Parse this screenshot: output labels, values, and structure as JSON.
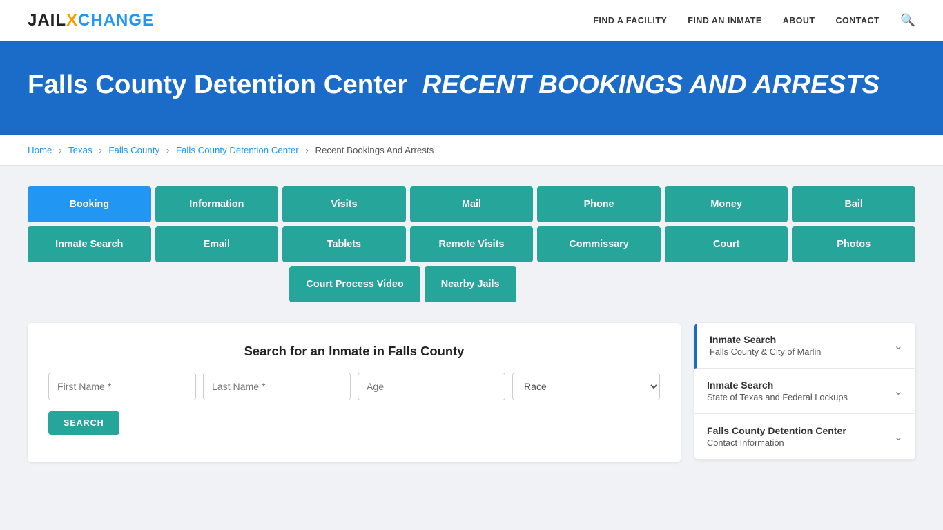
{
  "nav": {
    "logo_jail": "JAIL",
    "logo_x": "X",
    "logo_change": "CHANGE",
    "links": [
      {
        "label": "FIND A FACILITY",
        "href": "#"
      },
      {
        "label": "FIND AN INMATE",
        "href": "#"
      },
      {
        "label": "ABOUT",
        "href": "#"
      },
      {
        "label": "CONTACT",
        "href": "#"
      }
    ]
  },
  "hero": {
    "title_main": "Falls County Detention Center",
    "title_italic": "RECENT BOOKINGS AND ARRESTS"
  },
  "breadcrumb": {
    "items": [
      {
        "label": "Home",
        "href": "#"
      },
      {
        "label": "Texas",
        "href": "#"
      },
      {
        "label": "Falls County",
        "href": "#"
      },
      {
        "label": "Falls County Detention Center",
        "href": "#"
      },
      {
        "label": "Recent Bookings And Arrests",
        "href": "#"
      }
    ]
  },
  "buttons_row1": [
    {
      "label": "Booking",
      "active": true
    },
    {
      "label": "Information",
      "active": false
    },
    {
      "label": "Visits",
      "active": false
    },
    {
      "label": "Mail",
      "active": false
    },
    {
      "label": "Phone",
      "active": false
    },
    {
      "label": "Money",
      "active": false
    },
    {
      "label": "Bail",
      "active": false
    }
  ],
  "buttons_row2": [
    {
      "label": "Inmate Search",
      "active": false
    },
    {
      "label": "Email",
      "active": false
    },
    {
      "label": "Tablets",
      "active": false
    },
    {
      "label": "Remote Visits",
      "active": false
    },
    {
      "label": "Commissary",
      "active": false
    },
    {
      "label": "Court",
      "active": false
    },
    {
      "label": "Photos",
      "active": false
    }
  ],
  "buttons_row3": [
    {
      "label": "Court Process Video"
    },
    {
      "label": "Nearby Jails"
    }
  ],
  "search": {
    "heading": "Search for an Inmate in Falls County",
    "first_name_placeholder": "First Name *",
    "last_name_placeholder": "Last Name *",
    "age_placeholder": "Age",
    "race_placeholder": "Race",
    "button_label": "SEARCH"
  },
  "sidebar": [
    {
      "title": "Inmate Search",
      "sub": "Falls County & City of Marlin",
      "highlighted": true
    },
    {
      "title": "Inmate Search",
      "sub": "State of Texas and Federal Lockups",
      "highlighted": false
    },
    {
      "title": "Falls County Detention Center",
      "sub": "Contact Information",
      "highlighted": false
    }
  ]
}
